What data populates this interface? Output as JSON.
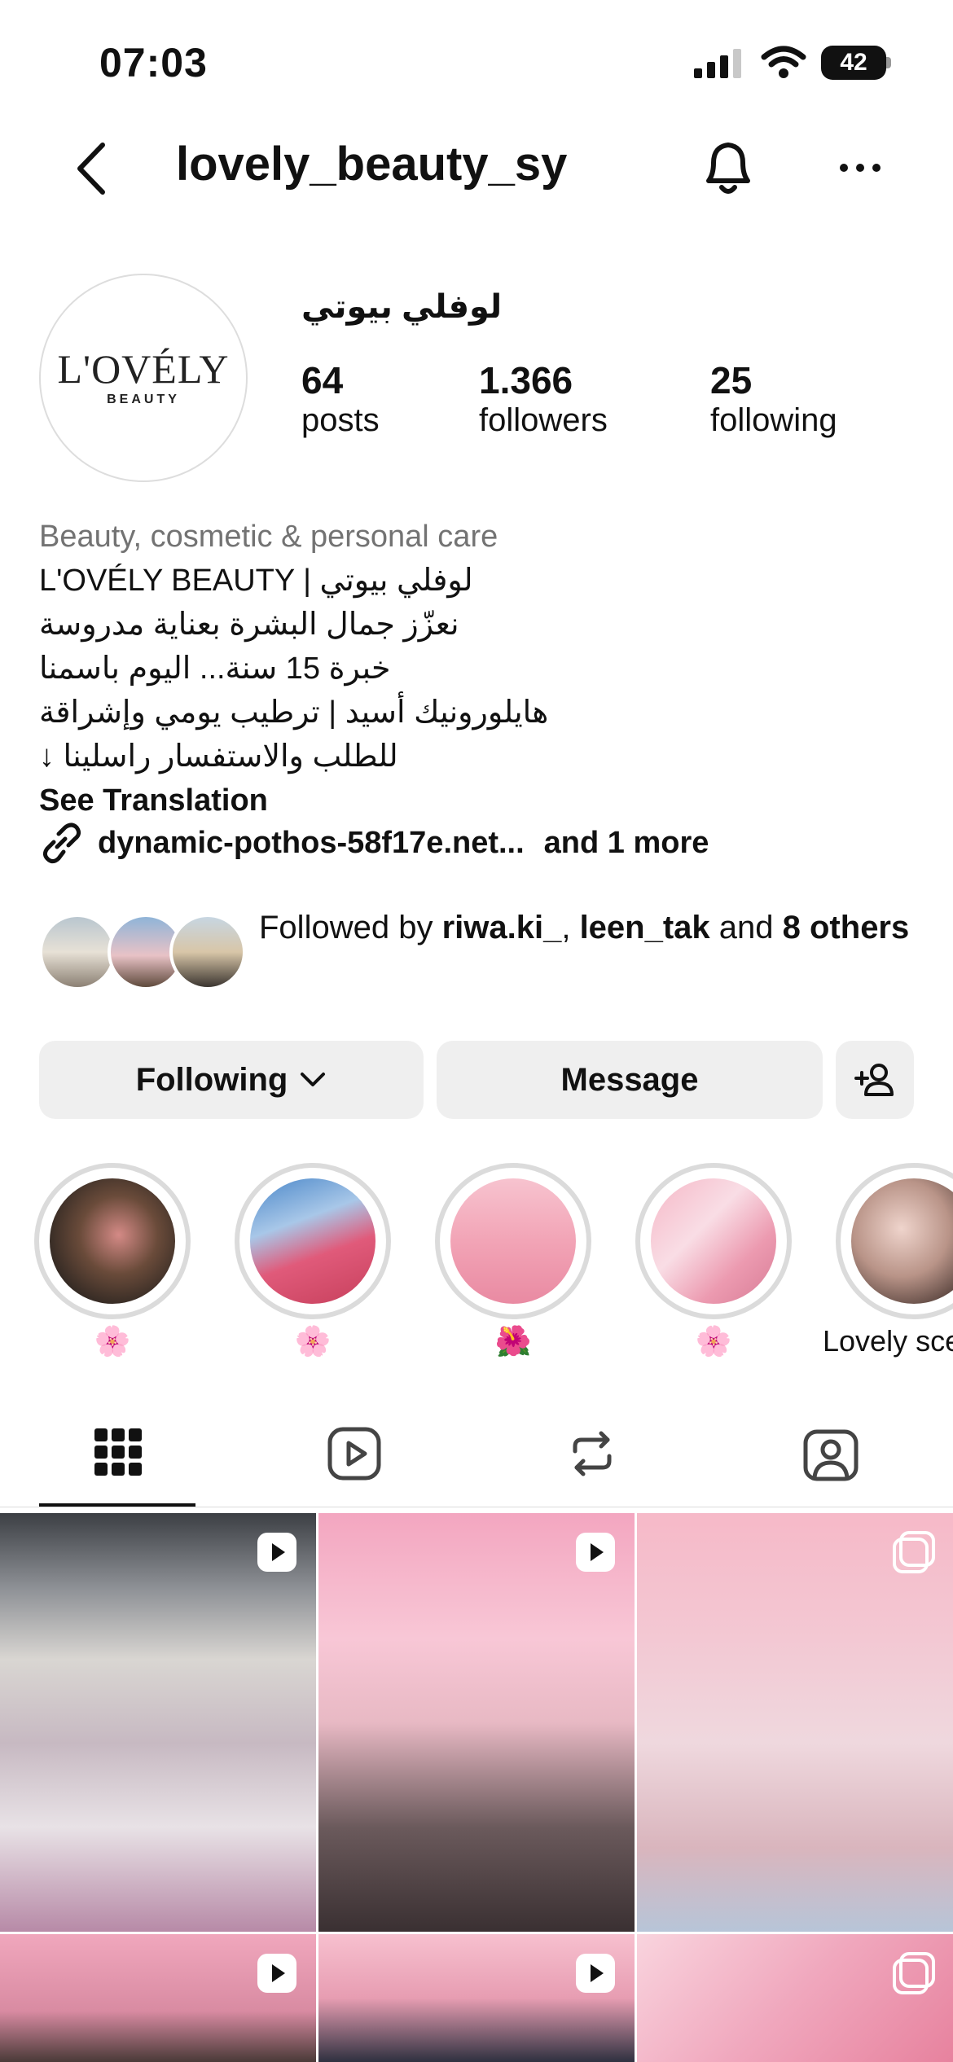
{
  "status_bar": {
    "time": "07:03",
    "battery": "42"
  },
  "header": {
    "username": "lovely_beauty_sy"
  },
  "profile": {
    "avatar_logo": "L'OVÉLY",
    "avatar_logo_sub": "BEAUTY",
    "display_name": "لوفلي بيوتي",
    "stats": [
      {
        "value": "64",
        "label": "posts"
      },
      {
        "value": "1.366",
        "label": "followers"
      },
      {
        "value": "25",
        "label": "following"
      }
    ]
  },
  "bio": {
    "category": "Beauty, cosmetic & personal care",
    "lines": [
      "L'OVÉLY BEAUTY | لوفلي بيوتي",
      "نعزّز جمال البشرة بعناية مدروسة",
      "خبرة 15 سنة... اليوم باسمنا",
      "هايلورونيك أسيد | ترطيب يومي وإشراقة",
      "للطلب والاستفسار راسلينا ↓"
    ],
    "see_translation": "See Translation",
    "link": "dynamic-pothos-58f17e.net...",
    "link_more": "and 1 more"
  },
  "followed_by": {
    "prefix": "Followed by ",
    "user1": "riwa.ki_",
    "sep": ", ",
    "user2": "leen_tak",
    "and": " and ",
    "others": "8 others"
  },
  "actions": {
    "following_label": "Following",
    "message_label": "Message"
  },
  "highlights": [
    {
      "label": "🌸"
    },
    {
      "label": "🌸"
    },
    {
      "label": "🌺"
    },
    {
      "label": "🌸"
    },
    {
      "label": "Lovely sce"
    }
  ],
  "tabs": [
    "grid-icon",
    "reels-icon",
    "reposts-icon",
    "tagged-icon"
  ],
  "colors": {
    "muted": "#737373",
    "button_bg": "#efefef",
    "divider": "#dbdbdb"
  }
}
